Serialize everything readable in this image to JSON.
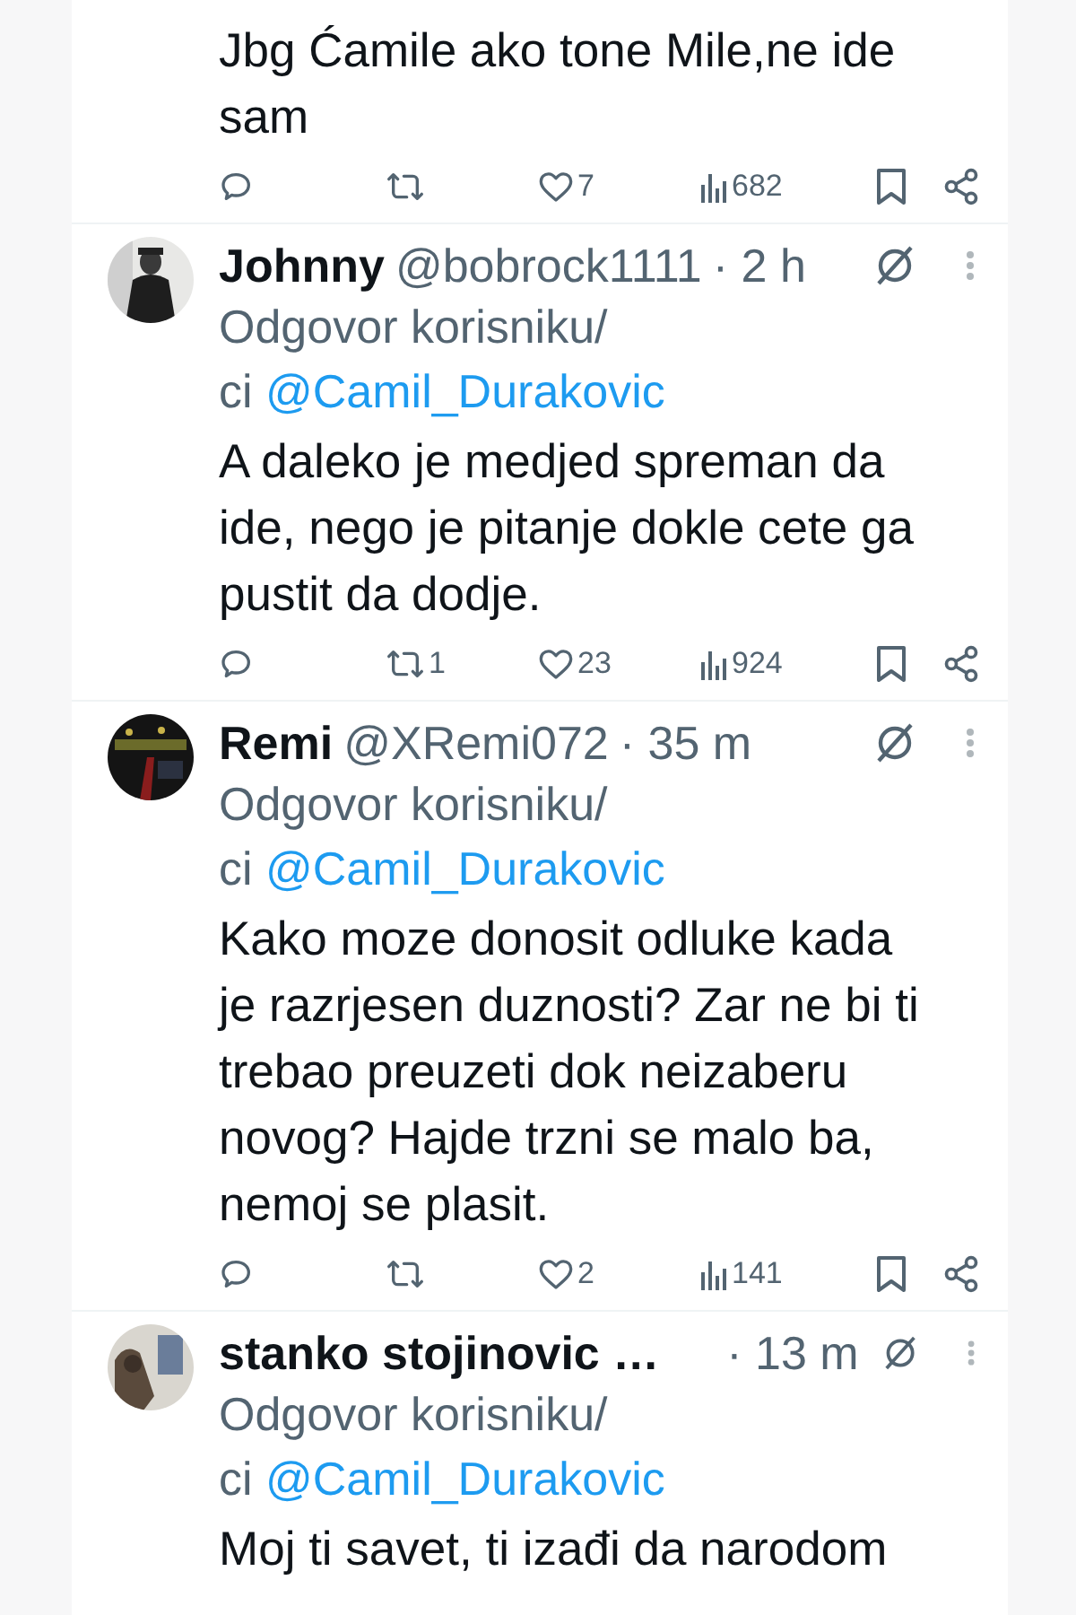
{
  "tweets": [
    {
      "text": "Jbg Ćamile ako tone Mile,ne ide sam",
      "actions": {
        "likes": "7",
        "views": "682"
      }
    },
    {
      "name": "Johnny",
      "handle": "@bobrock1111",
      "time": "· 2 h",
      "reply_prefix": "Odgovor korisniku/ci",
      "reply_to": "@Camil_Durakovic",
      "text": "A daleko je medjed spreman da ide, nego je pitanje dokle cete ga pustit da dodje.",
      "actions": {
        "retweets": "1",
        "likes": "23",
        "views": "924"
      }
    },
    {
      "name": "Remi",
      "handle": "@XRemi072",
      "time": "· 35 m",
      "reply_prefix": "Odgovor korisniku/ci",
      "reply_to": "@Camil_Durakovic",
      "text": "Kako moze donosit odluke kada je razrjesen duznosti? Zar ne bi ti trebao preuzeti dok neizaberu novog? Hajde trzni se malo ba, nemoj se plasit.",
      "actions": {
        "likes": "2",
        "views": "141"
      }
    },
    {
      "name": "stanko stojinovic …",
      "time": "· 13 m",
      "reply_prefix": "Odgovor korisniku/ci",
      "reply_to": "@Camil_Durakovic",
      "text": "Moj ti savet, ti izađi da narodom"
    }
  ]
}
